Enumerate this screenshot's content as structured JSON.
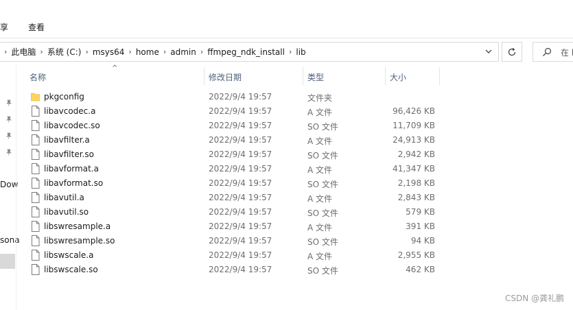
{
  "ribbon": {
    "tabs": [
      {
        "label": "享"
      },
      {
        "label": "查看"
      }
    ]
  },
  "address": {
    "crumbs": [
      "此电脑",
      "系统 (C:)",
      "msys64",
      "home",
      "admin",
      "ffmpeg_ndk_install",
      "lib"
    ],
    "search_placeholder": "在 l"
  },
  "nav": {
    "items": [
      {
        "label": "Dow"
      },
      {
        "label": "sona"
      }
    ]
  },
  "columns": {
    "name": "名称",
    "date": "修改日期",
    "type": "类型",
    "size": "大小"
  },
  "files": [
    {
      "name": "pkgconfig",
      "date": "2022/9/4 19:57",
      "type": "文件夹",
      "size": "",
      "kind": "folder"
    },
    {
      "name": "libavcodec.a",
      "date": "2022/9/4 19:57",
      "type": "A 文件",
      "size": "96,426 KB",
      "kind": "file"
    },
    {
      "name": "libavcodec.so",
      "date": "2022/9/4 19:57",
      "type": "SO 文件",
      "size": "11,709 KB",
      "kind": "file"
    },
    {
      "name": "libavfilter.a",
      "date": "2022/9/4 19:57",
      "type": "A 文件",
      "size": "24,913 KB",
      "kind": "file"
    },
    {
      "name": "libavfilter.so",
      "date": "2022/9/4 19:57",
      "type": "SO 文件",
      "size": "2,942 KB",
      "kind": "file"
    },
    {
      "name": "libavformat.a",
      "date": "2022/9/4 19:57",
      "type": "A 文件",
      "size": "41,347 KB",
      "kind": "file"
    },
    {
      "name": "libavformat.so",
      "date": "2022/9/4 19:57",
      "type": "SO 文件",
      "size": "2,198 KB",
      "kind": "file"
    },
    {
      "name": "libavutil.a",
      "date": "2022/9/4 19:57",
      "type": "A 文件",
      "size": "2,843 KB",
      "kind": "file"
    },
    {
      "name": "libavutil.so",
      "date": "2022/9/4 19:57",
      "type": "SO 文件",
      "size": "579 KB",
      "kind": "file"
    },
    {
      "name": "libswresample.a",
      "date": "2022/9/4 19:57",
      "type": "A 文件",
      "size": "391 KB",
      "kind": "file"
    },
    {
      "name": "libswresample.so",
      "date": "2022/9/4 19:57",
      "type": "SO 文件",
      "size": "94 KB",
      "kind": "file"
    },
    {
      "name": "libswscale.a",
      "date": "2022/9/4 19:57",
      "type": "A 文件",
      "size": "2,955 KB",
      "kind": "file"
    },
    {
      "name": "libswscale.so",
      "date": "2022/9/4 19:57",
      "type": "SO 文件",
      "size": "462 KB",
      "kind": "file"
    }
  ],
  "watermark": "CSDN @龚礼鹏",
  "colors": {
    "folder": "#ffd45c",
    "header_text": "#4c607a",
    "secondary_text": "#6d6d6d"
  }
}
